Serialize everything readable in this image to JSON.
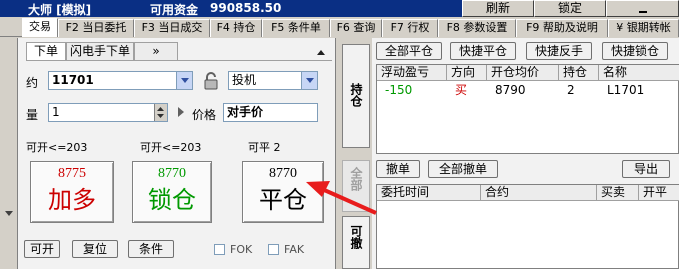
{
  "titlebar": {
    "app_title": "大师 [模拟]",
    "funds_label": "可用资金",
    "funds_value": "990858.50",
    "refresh": "刷新",
    "lock": "锁定"
  },
  "tabs": [
    {
      "label": "交易",
      "active": true
    },
    {
      "label": "F2 当日委托"
    },
    {
      "label": "F3 当日成交"
    },
    {
      "label": "F4 持仓"
    },
    {
      "label": "F5 条件单"
    },
    {
      "label": "F6 查询"
    },
    {
      "label": "F7 行权"
    },
    {
      "label": "F8 参数设置"
    },
    {
      "label": "F9 帮助及说明"
    },
    {
      "label": "¥ 银期转帐"
    }
  ],
  "order_panel": {
    "subtabs": [
      "下单",
      "闪电手下单",
      "»"
    ],
    "contract_label": "约",
    "contract_value": "11701",
    "hedge_value": "投机",
    "qty_label": "量",
    "qty_value": "1",
    "price_label": "价格",
    "price_value": "对手价",
    "buy": {
      "avail": "可开<=203",
      "price": "8775",
      "action": "加多"
    },
    "lock": {
      "avail": "可开<=203",
      "price": "8770",
      "action": "锁仓"
    },
    "close": {
      "avail": "可平 2",
      "price": "8770",
      "action": "平仓"
    },
    "bottom_buttons": [
      "可开",
      "复位",
      "条件"
    ],
    "fok_label": "FOK",
    "fak_label": "FAK"
  },
  "side_buttons": {
    "positions": "持仓",
    "all": "全部",
    "cancelable": "可撤"
  },
  "positions": {
    "buttons": [
      "全部平仓",
      "快捷平仓",
      "快捷反手",
      "快捷锁仓"
    ],
    "columns": [
      "浮动盈亏",
      "方向",
      "开仓均价",
      "持仓",
      "名称"
    ],
    "rows": [
      {
        "pnl": "-150",
        "direction": "买",
        "avg_price": "8790",
        "qty": "2",
        "name": "L1701"
      }
    ]
  },
  "orders": {
    "buttons": [
      "撤单",
      "全部撤单"
    ],
    "export": "导出",
    "columns": [
      "委托时间",
      "合约",
      "买卖",
      "开平"
    ]
  },
  "colors": {
    "buy": "#cc0000",
    "lock": "#009900",
    "title_bg": "#0a2f84",
    "arrow": "#e81c1c"
  }
}
